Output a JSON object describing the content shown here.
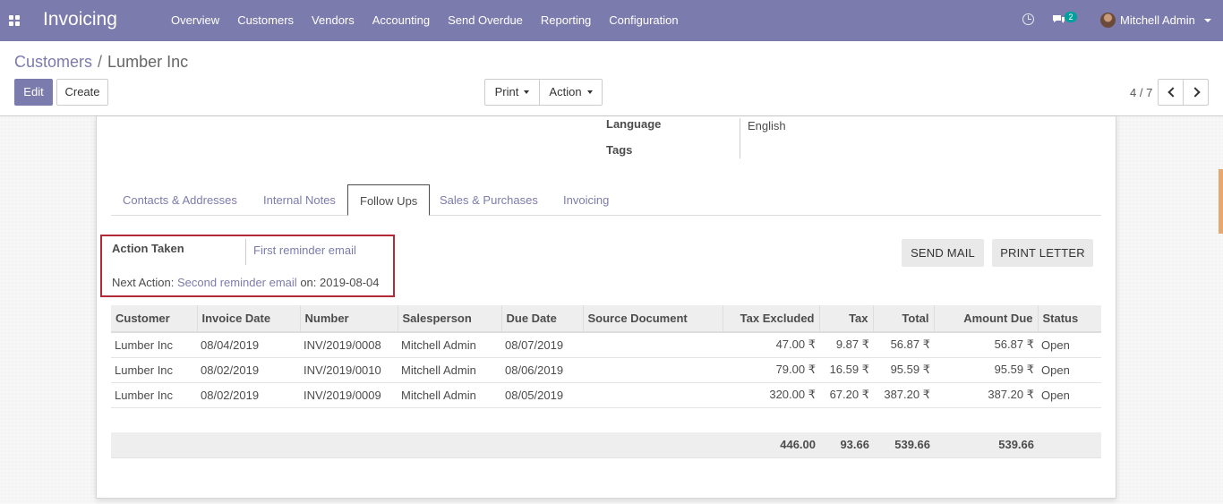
{
  "navbar": {
    "app_title": "Invoicing",
    "menu": [
      "Overview",
      "Customers",
      "Vendors",
      "Accounting",
      "Send Overdue",
      "Reporting",
      "Configuration"
    ],
    "messages_badge": "2",
    "user": "Mitchell Admin"
  },
  "breadcrumb": {
    "parent": "Customers",
    "separator": "/",
    "current": "Lumber Inc"
  },
  "buttons": {
    "edit": "Edit",
    "create": "Create",
    "print": "Print",
    "action": "Action"
  },
  "pager": {
    "value": "4 / 7"
  },
  "form": {
    "language_label": "Language",
    "language_value": "English",
    "tags_label": "Tags"
  },
  "tabs": [
    "Contacts & Addresses",
    "Internal Notes",
    "Follow Ups",
    "Sales & Purchases",
    "Invoicing"
  ],
  "active_tab": "Follow Ups",
  "followup": {
    "action_taken_label": "Action Taken",
    "action_taken_value": "First reminder email",
    "next_action_prefix": "Next Action:",
    "next_action_value": "Second reminder email",
    "next_action_on": "on:",
    "next_action_date": "2019-08-04",
    "send_mail": "SEND MAIL",
    "print_letter": "PRINT LETTER"
  },
  "table": {
    "columns": [
      "Customer",
      "Invoice Date",
      "Number",
      "Salesperson",
      "Due Date",
      "Source Document",
      "Tax Excluded",
      "Tax",
      "Total",
      "Amount Due",
      "Status"
    ],
    "rows": [
      {
        "customer": "Lumber Inc",
        "invoice_date": "08/04/2019",
        "number": "INV/2019/0008",
        "salesperson": "Mitchell Admin",
        "due_date": "08/07/2019",
        "source": "",
        "tax_excluded": "47.00 ₹",
        "tax": "9.87 ₹",
        "total": "56.87 ₹",
        "amount_due": "56.87 ₹",
        "status": "Open"
      },
      {
        "customer": "Lumber Inc",
        "invoice_date": "08/02/2019",
        "number": "INV/2019/0010",
        "salesperson": "Mitchell Admin",
        "due_date": "08/06/2019",
        "source": "",
        "tax_excluded": "79.00 ₹",
        "tax": "16.59 ₹",
        "total": "95.59 ₹",
        "amount_due": "95.59 ₹",
        "status": "Open"
      },
      {
        "customer": "Lumber Inc",
        "invoice_date": "08/02/2019",
        "number": "INV/2019/0009",
        "salesperson": "Mitchell Admin",
        "due_date": "08/05/2019",
        "source": "",
        "tax_excluded": "320.00 ₹",
        "tax": "67.20 ₹",
        "total": "387.20 ₹",
        "amount_due": "387.20 ₹",
        "status": "Open"
      }
    ],
    "totals": {
      "tax_excluded": "446.00",
      "tax": "93.66",
      "total": "539.66",
      "amount_due": "539.66"
    }
  },
  "colors": {
    "brand": "#7c7bad",
    "highlight_border": "#b22a35",
    "badge": "#00a09d"
  }
}
